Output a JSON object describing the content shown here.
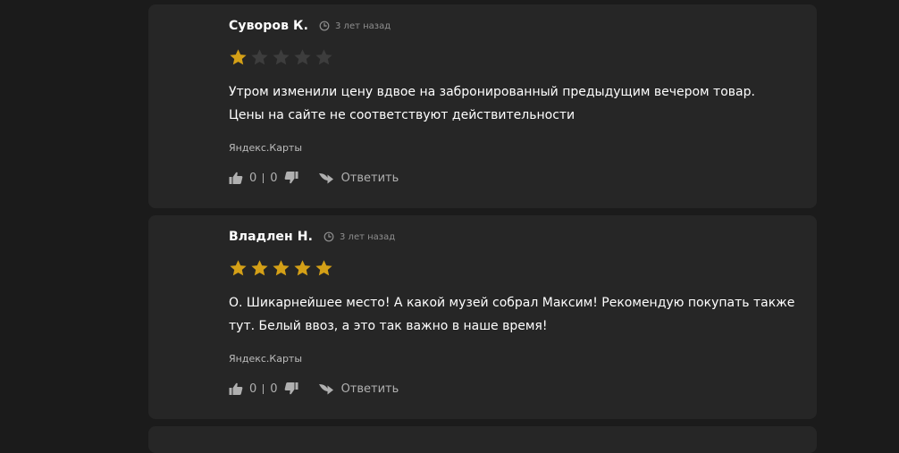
{
  "reviews": [
    {
      "author": "Суворов К.",
      "time": "3 лет назад",
      "rating": 1,
      "text_lines": [
        "Утром изменили цену вдвое на забронированный предыдущим вечером товар.",
        "Цены на сайте не соответствуют действительности"
      ],
      "source": "Яндекс.Карты",
      "likes": "0",
      "dislikes": "0",
      "reply_label": "Ответить"
    },
    {
      "author": "Владлен Н.",
      "time": "3 лет назад",
      "rating": 5,
      "text_lines": [
        "О. Шикарнейшее место! А какой музей собрал Максим! Рекомендую покупать также",
        "тут. Белый ввоз, а это так важно в наше время!"
      ],
      "source": "Яндекс.Карты",
      "likes": "0",
      "dislikes": "0",
      "reply_label": "Ответить"
    }
  ],
  "colors": {
    "background": "#1b1b1b",
    "card": "#262626",
    "star_filled": "#d4a017",
    "star_empty": "#3d3d3d",
    "text": "#ffffff",
    "muted": "#8f8f8f"
  },
  "icons": {
    "time": "clock-icon",
    "like": "thumbs-up-icon",
    "dislike": "thumbs-down-icon",
    "reply": "reply-arrow-icon",
    "rating": "star-icon"
  }
}
